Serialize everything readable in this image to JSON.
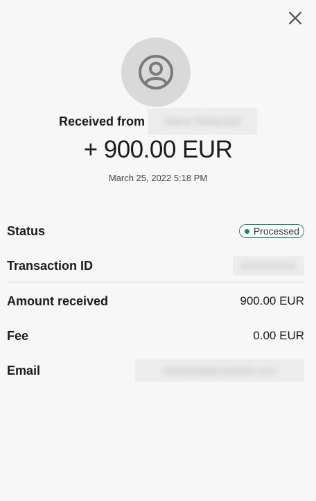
{
  "header": {
    "close_icon": "close-icon"
  },
  "sender": {
    "avatar_icon": "user-circle-icon",
    "received_label": "Received from",
    "name_blurred": "Name Redacted"
  },
  "transaction": {
    "amount": "+ 900.00 EUR",
    "datetime": "March 25, 2022 5:18 PM"
  },
  "details": {
    "status_label": "Status",
    "status_value": "Processed",
    "status_color": "#1d8a64",
    "transaction_id_label": "Transaction ID",
    "transaction_id_blurred": "XXXXXXXX",
    "amount_received_label": "Amount received",
    "amount_received_value": "900.00 EUR",
    "fee_label": "Fee",
    "fee_value": "0.00 EUR",
    "email_label": "Email",
    "email_blurred": "redacted@example.com"
  }
}
